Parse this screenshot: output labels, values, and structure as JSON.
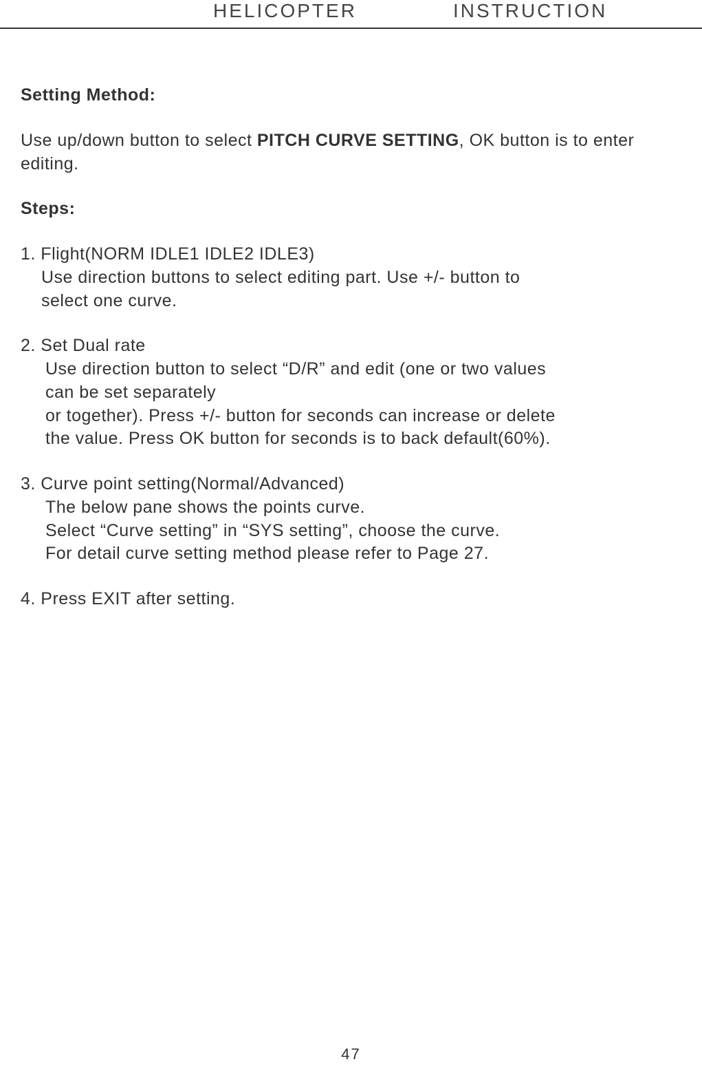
{
  "header": {
    "left": "HELICOPTER",
    "right": "INSTRUCTION"
  },
  "content": {
    "setting_method_heading": "Setting Method:",
    "intro_pre": "Use up/down button to select ",
    "intro_bold": "PITCH CURVE SETTING",
    "intro_post": ", OK button is to enter editing.",
    "steps_heading": "Steps:",
    "step1": {
      "title": "1. Flight(NORM IDLE1 IDLE2 IDLE3)",
      "line1": " Use direction buttons to select editing part. Use +/- button to",
      "line2": "select one curve."
    },
    "step2": {
      "title": "2. Set Dual rate",
      "line1": "Use direction button to select “D/R” and edit (one or two values",
      "line2": "can be set separately",
      "line3": "or together). Press +/- button for seconds can increase or delete",
      "line4": "the value. Press OK button for seconds  is to back default(60%)."
    },
    "step3": {
      "title": "3. Curve point setting(Normal/Advanced)",
      "line1": "The below pane shows the points curve.",
      "line2": "Select “Curve setting” in “SYS setting”, choose the curve.",
      "line3": "For detail curve setting method please refer to Page 27."
    },
    "step4": {
      "title": "4. Press EXIT after setting."
    }
  },
  "page_number": "47"
}
